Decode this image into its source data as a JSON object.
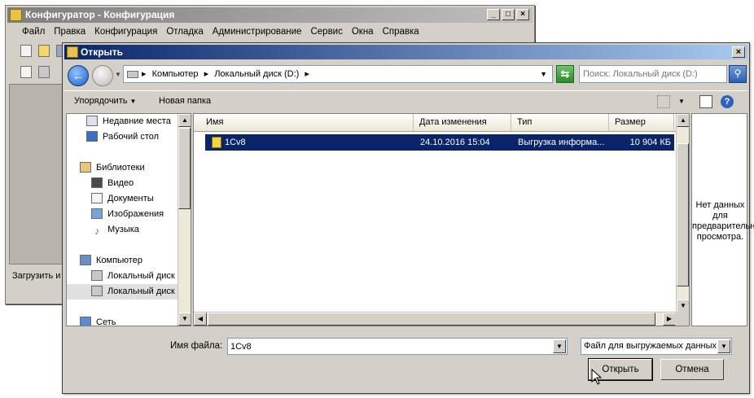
{
  "background_window": {
    "title": "Конфигуратор - Конфигурация",
    "menu": [
      "Файл",
      "Правка",
      "Конфигурация",
      "Отладка",
      "Администрирование",
      "Сервис",
      "Окна",
      "Справка"
    ],
    "status_text": "Загрузить и"
  },
  "dialog": {
    "title": "Открыть",
    "address": {
      "crumbs": [
        "Компьютер",
        "Локальный диск (D:)"
      ]
    },
    "search": {
      "placeholder": "Поиск: Локальный диск (D:)"
    },
    "toolbar": {
      "organize_label": "Упорядочить",
      "new_folder_label": "Новая папка"
    },
    "tree": {
      "items": [
        {
          "label": "Недавние места",
          "icon": "recent-places-icon"
        },
        {
          "label": "Рабочий стол",
          "icon": "desktop-icon"
        },
        {
          "label": "Библиотеки",
          "icon": "libraries-icon"
        },
        {
          "label": "Видео",
          "icon": "video-icon"
        },
        {
          "label": "Документы",
          "icon": "documents-icon"
        },
        {
          "label": "Изображения",
          "icon": "pictures-icon"
        },
        {
          "label": "Музыка",
          "icon": "music-icon"
        },
        {
          "label": "Компьютер",
          "icon": "computer-icon"
        },
        {
          "label": "Локальный диск (",
          "icon": "drive-icon"
        },
        {
          "label": "Локальный диск (",
          "icon": "drive-icon"
        },
        {
          "label": "Сеть",
          "icon": "network-icon"
        }
      ]
    },
    "columns": [
      "Имя",
      "Дата изменения",
      "Тип",
      "Размер"
    ],
    "rows": [
      {
        "name": "1Cv8",
        "date": "24.10.2016 15:04",
        "type": "Выгрузка информа...",
        "size": "10 904 КБ"
      }
    ],
    "preview_text": "Нет данных\nдля\nпредварительного\nпросмотра.",
    "filename_label": "Имя файла:",
    "filename_value": "1Cv8",
    "filetype_value": "Файл для выгружаемых данных",
    "open_label": "Открыть",
    "cancel_label": "Отмена"
  }
}
